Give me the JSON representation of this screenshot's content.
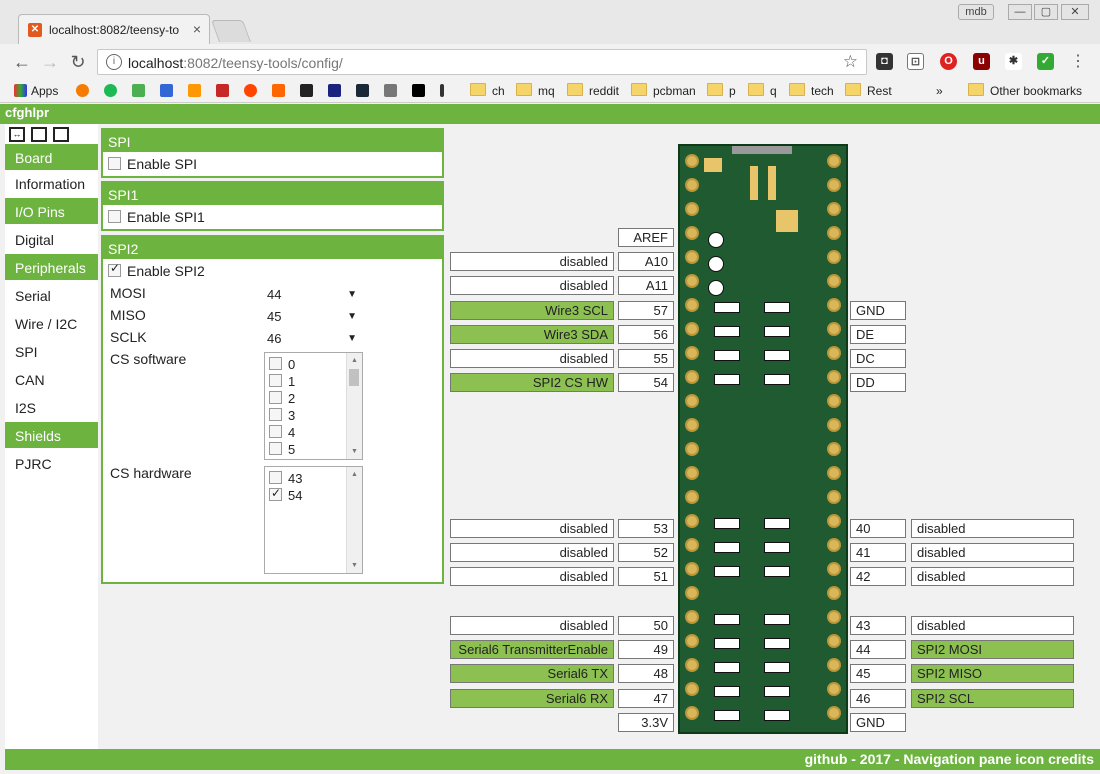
{
  "browser": {
    "tab_title": "localhost:8082/teensy-to",
    "user_badge": "mdb",
    "url_host": "localhost",
    "url_rest": ":8082/teensy-tools/config/"
  },
  "bookmarks": [
    "Apps",
    "ch",
    "mq",
    "reddit",
    "pcbman",
    "p",
    "q",
    "tech",
    "Rest",
    "Other bookmarks"
  ],
  "app": {
    "name": "cfghlpr",
    "footer": "github - 2017 - Navigation pane icon credits"
  },
  "sidebar": {
    "sections": [
      "Board",
      "I/O Pins",
      "Peripherals",
      "Shields"
    ],
    "items": [
      "Information",
      "Digital",
      "Serial",
      "Wire / I2C",
      "SPI",
      "CAN",
      "I2S",
      "PJRC"
    ]
  },
  "panels": {
    "spi": {
      "title": "SPI",
      "enable": "Enable SPI"
    },
    "spi1": {
      "title": "SPI1",
      "enable": "Enable SPI1"
    },
    "spi2": {
      "title": "SPI2",
      "enable": "Enable SPI2",
      "mosi_label": "MOSI",
      "mosi": "44",
      "miso_label": "MISO",
      "miso": "45",
      "sclk_label": "SCLK",
      "sclk": "46",
      "cs_sw_label": "CS software",
      "cs_sw_options": [
        "0",
        "1",
        "2",
        "3",
        "4",
        "5"
      ],
      "cs_hw_label": "CS hardware",
      "cs_hw_options": [
        "43",
        "54"
      ]
    }
  },
  "pins_left": {
    "aref": "AREF",
    "a10_fn": "disabled",
    "a10": "A10",
    "a11_fn": "disabled",
    "a11": "A11",
    "p57_fn": "Wire3 SCL",
    "p57": "57",
    "p56_fn": "Wire3 SDA",
    "p56": "56",
    "p55_fn": "disabled",
    "p55": "55",
    "p54_fn": "SPI2 CS HW",
    "p54": "54",
    "p53_fn": "disabled",
    "p53": "53",
    "p52_fn": "disabled",
    "p52": "52",
    "p51_fn": "disabled",
    "p51": "51",
    "p50_fn": "disabled",
    "p50": "50",
    "p49_fn": "Serial6 TransmitterEnable",
    "p49": "49",
    "p48_fn": "Serial6 TX",
    "p48": "48",
    "p47_fn": "Serial6 RX",
    "p47": "47",
    "v33": "3.3V"
  },
  "pins_right": {
    "gnd1": "GND",
    "de": "DE",
    "dc": "DC",
    "dd": "DD",
    "p40": "40",
    "p40_fn": "disabled",
    "p41": "41",
    "p41_fn": "disabled",
    "p42": "42",
    "p42_fn": "disabled",
    "p43": "43",
    "p43_fn": "disabled",
    "p44": "44",
    "p44_fn": "SPI2 MOSI",
    "p45": "45",
    "p45_fn": "SPI2 MISO",
    "p46": "46",
    "p46_fn": "SPI2 SCL",
    "gnd2": "GND"
  }
}
